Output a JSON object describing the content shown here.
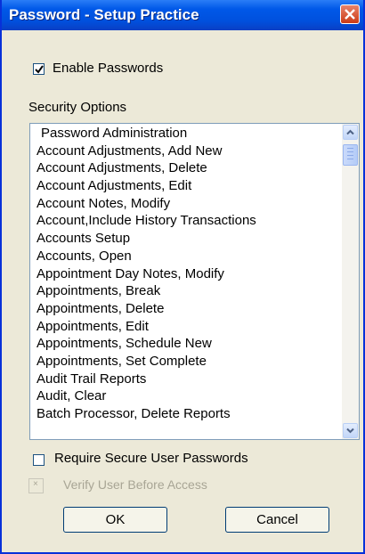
{
  "window": {
    "title": "Password - Setup Practice"
  },
  "enable_passwords": {
    "label": "Enable Passwords",
    "checked": true
  },
  "security_options": {
    "label": "Security Options",
    "items": [
      "Password Administration",
      "Account Adjustments, Add New",
      "Account Adjustments, Delete",
      "Account Adjustments, Edit",
      "Account Notes, Modify",
      "Account,Include History Transactions",
      "Accounts Setup",
      "Accounts, Open",
      "Appointment Day Notes, Modify",
      "Appointments, Break",
      "Appointments, Delete",
      "Appointments, Edit",
      "Appointments, Schedule New",
      "Appointments, Set Complete",
      "Audit Trail Reports",
      "Audit, Clear",
      "Batch Processor, Delete Reports"
    ]
  },
  "require_secure": {
    "label": "Require Secure User Passwords",
    "checked": false
  },
  "verify_user": {
    "label": "Verify User Before Access",
    "mark": "×",
    "enabled": false
  },
  "buttons": {
    "ok": "OK",
    "cancel": "Cancel"
  },
  "icons": {
    "close": "close-icon",
    "check": "checkmark-icon",
    "up": "scroll-up-icon",
    "down": "scroll-down-icon"
  },
  "colors": {
    "titlebar": "#0058E8",
    "face": "#ECE9D8",
    "close": "#CC3B16"
  }
}
